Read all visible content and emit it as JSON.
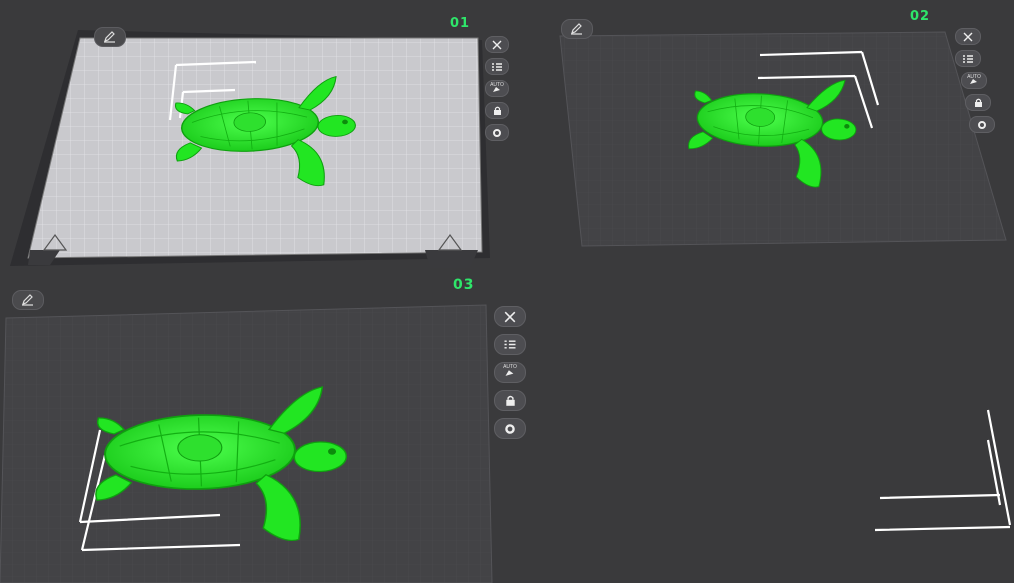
{
  "plates": [
    {
      "number": "01",
      "active": true,
      "brand_left": "Warning! Hot Surface",
      "brand_right": "Warning! Hot Surface",
      "tools": [
        "close-icon",
        "arrange-list-icon",
        "auto-orient-icon",
        "lock-icon",
        "gear-icon"
      ],
      "auto_label": "AUTO"
    },
    {
      "number": "02",
      "active": false,
      "tools": [
        "close-icon",
        "arrange-list-icon",
        "auto-orient-icon",
        "lock-icon",
        "gear-icon"
      ],
      "auto_label": "AUTO"
    },
    {
      "number": "03",
      "active": false,
      "tools": [
        "close-icon",
        "arrange-list-icon",
        "auto-orient-icon",
        "lock-icon",
        "gear-icon"
      ],
      "auto_label": "AUTO"
    }
  ],
  "model": {
    "name": "turtle",
    "color": "#22e622"
  },
  "colors": {
    "background": "#3a3a3c",
    "plate_active": "#c8c8cc",
    "plate_inactive": "#444447",
    "accent": "#2ee66a"
  }
}
